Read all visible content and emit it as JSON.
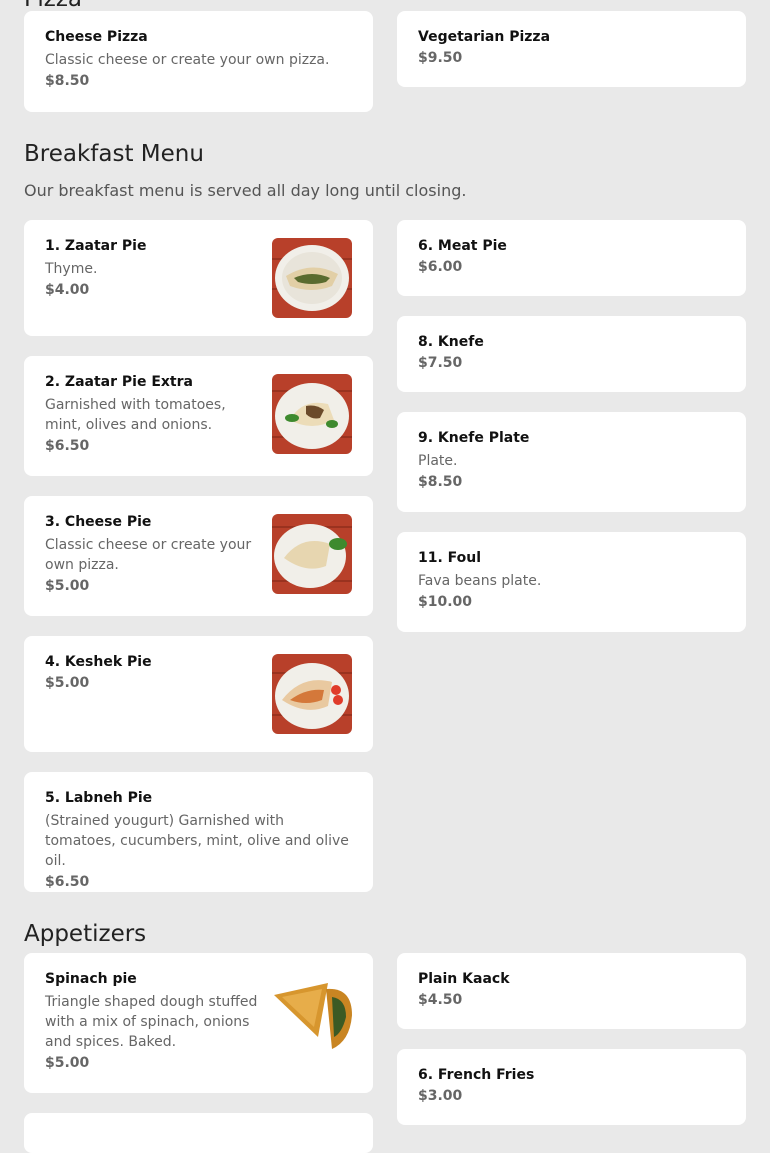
{
  "pizza": {
    "title_fragment": "Pizza",
    "items": [
      {
        "name": "Cheese Pizza",
        "desc": "Classic cheese or create your own pizza.",
        "price": "$8.50"
      },
      {
        "name": "Vegetarian Pizza",
        "desc": "",
        "price": "$9.50"
      }
    ]
  },
  "breakfast": {
    "title": "Breakfast Menu",
    "subtitle": "Our breakfast menu is served all day long until closing.",
    "items": [
      {
        "name": "1. Zaatar Pie",
        "desc": "Thyme.",
        "price": "$4.00",
        "thumb": "zaatar-pie"
      },
      {
        "name": "2. Zaatar Pie Extra",
        "desc": "Garnished with tomatoes, mint, olives and onions.",
        "price": "$6.50",
        "thumb": "zaatar-extra"
      },
      {
        "name": "3. Cheese Pie",
        "desc": "Classic cheese or create your own pizza.",
        "price": "$5.00",
        "thumb": "cheese-pie"
      },
      {
        "name": "4. Keshek Pie",
        "desc": "",
        "price": "$5.00",
        "thumb": "keshek-pie"
      },
      {
        "name": "5. Labneh Pie",
        "desc": "(Strained yougurt) Garnished with tomatoes, cucumbers, mint, olive and olive oil.",
        "price": "$6.50"
      },
      {
        "name": "6. Meat Pie",
        "desc": "",
        "price": "$6.00"
      },
      {
        "name": "8. Knefe",
        "desc": "",
        "price": "$7.50"
      },
      {
        "name": "9. Knefe Plate",
        "desc": "Plate.",
        "price": "$8.50"
      },
      {
        "name": "11. Foul",
        "desc": "Fava beans plate.",
        "price": "$10.00"
      }
    ]
  },
  "appetizers": {
    "title": "Appetizers",
    "items": [
      {
        "name": "Spinach pie",
        "desc": "Triangle shaped dough stuffed with a mix of spinach, onions and spices. Baked.",
        "price": "$5.00",
        "thumb": "spinach-pie"
      },
      {
        "name": "Plain Kaack",
        "desc": "",
        "price": "$4.50"
      },
      {
        "name": "6. French Fries",
        "desc": "",
        "price": "$3.00"
      }
    ]
  },
  "colors": {
    "background": "#e9e9e9",
    "card": "#ffffff",
    "price": "#666666",
    "table": "#c2412a"
  }
}
